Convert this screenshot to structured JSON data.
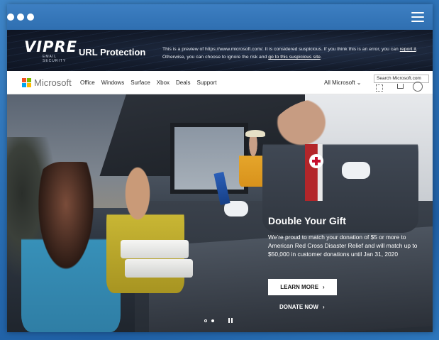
{
  "window": {
    "menu_icon": "hamburger-menu-icon",
    "dots_icon": "window-dots-icon"
  },
  "vipre": {
    "logo_text": "VIPRE",
    "logo_subtext": "EMAIL SECURITY",
    "title": "URL Protection",
    "message_prefix": "This is a preview of https://www.microsoft.com/. It is considered suspicious. If you think this is an error, you can ",
    "report_link": "report it",
    "message_middle": ". Otherwise, you can choose to ignore the risk and ",
    "ignore_link": "go to this suspicious site",
    "message_suffix": "."
  },
  "ms_nav": {
    "brand": "Microsoft",
    "links": [
      "Office",
      "Windows",
      "Surface",
      "Xbox",
      "Deals",
      "Support"
    ],
    "all_microsoft": "All Microsoft",
    "search_tooltip": "Search Microsoft.com"
  },
  "hero": {
    "title": "Double Your Gift",
    "body": "We’re proud to match your donation of $5 or more to American Red Cross Disaster Relief and will match up to $50,000 in customer donations until Jan 31, 2020",
    "learn_more": "LEARN MORE",
    "donate_now": "DONATE NOW",
    "chevron": "›"
  },
  "colors": {
    "vipre_bg": "#141c2c",
    "ms_red": "#f25022",
    "ms_green": "#7fba00",
    "ms_blue": "#00a4ef",
    "ms_yellow": "#ffb900",
    "page_bg": "#2a6fb4"
  }
}
